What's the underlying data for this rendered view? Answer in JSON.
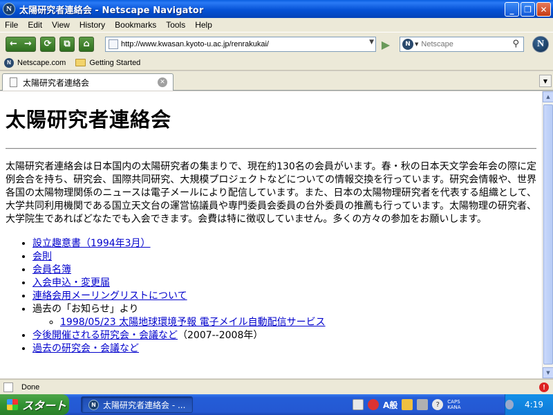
{
  "window": {
    "title": "太陽研究者連絡会 - Netscape Navigator",
    "app_icon_letter": "N"
  },
  "menu": [
    "File",
    "Edit",
    "View",
    "History",
    "Bookmarks",
    "Tools",
    "Help"
  ],
  "toolbar": {
    "url": "http://www.kwasan.kyoto-u.ac.jp/renrakukai/",
    "search_placeholder": "Netscape"
  },
  "bookmarks": [
    {
      "label": "Netscape.com",
      "icon": "netscape-icon"
    },
    {
      "label": "Getting Started",
      "icon": "folder-icon"
    }
  ],
  "tab": {
    "label": "太陽研究者連絡会"
  },
  "page": {
    "heading": "太陽研究者連絡会",
    "intro": "太陽研究者連絡会は日本国内の太陽研究者の集まりで、現在約130名の会員がいます。春・秋の日本天文学会年会の際に定例会合を持ち、研究会、国際共同研究、大規模プロジェクトなどについての情報交換を行っています。研究会情報や、世界各国の太陽物理関係のニュースは電子メールにより配信しています。また、日本の太陽物理研究者を代表する組織として、大学共同利用機関である国立天文台の運営協議員や専門委員会委員の台外委員の推薦も行っています。太陽物理の研究者、大学院生であればどなたでも入会できます。会費は特に徴収していません。多くの方々の参加をお願いします。",
    "links": {
      "prospectus": "設立趣意書（1994年3月）",
      "bylaws": "会則",
      "members": "会員名簿",
      "join": "入会申込・変更届",
      "mailing_list": "連絡会用メーリングリストについて",
      "past_notices_label": "過去の「お知らせ」より",
      "past_notice_item": "1998/05/23 太陽地球環境予報 電子メイル自動配信サービス",
      "upcoming": "今後開催される研究会・会議など",
      "upcoming_suffix": "（2007--2008年）",
      "past_meetings": "過去の研究会・会議など"
    }
  },
  "status": {
    "text": "Done"
  },
  "taskbar": {
    "start_label": "スタート",
    "task_label": "太陽研究者連絡会 - ...",
    "ime_text": "A般",
    "caps": "CAPS",
    "kana": "KANA",
    "clock": "4:19"
  },
  "colors": {
    "link": "#0000cc",
    "titlebar": "#0552d6",
    "taskbar": "#245dd8",
    "start": "#329232"
  }
}
